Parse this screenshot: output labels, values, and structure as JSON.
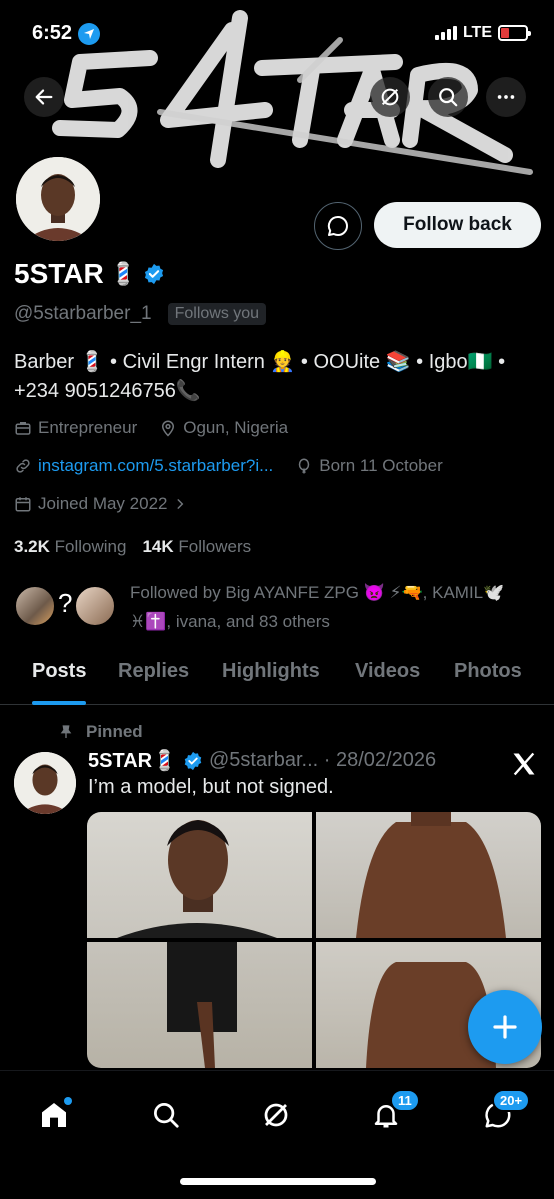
{
  "status_bar": {
    "time": "6:52",
    "network": "LTE"
  },
  "header": {
    "banner_text": "5STAR",
    "back_icon": "arrow-left-icon",
    "grok_icon": "grok-icon",
    "search_icon": "search-icon",
    "more_icon": "more-icon"
  },
  "profile": {
    "follow_back_label": "Follow back",
    "name": "5STAR",
    "name_emoji": "💈",
    "handle": "@5starbarber_1",
    "follows_you": "Follows you",
    "bio_line1": "Barber 💈 • Civil Engr Intern 👷 • OOUite 📚 • Igbo🇳🇬 •",
    "bio_line2": "+234 9051246756📞",
    "category": "Entrepreneur",
    "location": "Ogun, Nigeria",
    "website": "instagram.com/5.starbarber?i...",
    "birthday": "Born 11 October",
    "joined": "Joined May 2022",
    "following_count": "3.2K",
    "following_label": "Following",
    "followers_count": "14K",
    "followers_label": "Followers",
    "followed_by_line1": "Followed by Big AYANFE ZPG 👿 ⚡🔫, KAMIL🕊️",
    "followed_by_line2": "♓✝️, ivana, and 83 others"
  },
  "tabs": [
    "Posts",
    "Replies",
    "Highlights",
    "Videos",
    "Photos"
  ],
  "post": {
    "pinned_label": "Pinned",
    "name": "5STAR💈",
    "meta": "@5starbar... · 28/02/2026",
    "text": "I’m a model, but not signed."
  },
  "nav": {
    "notifications_badge": "11",
    "messages_badge": "20+"
  },
  "colors": {
    "accent": "#1d9bf0",
    "background": "#000000",
    "muted": "#71767b"
  }
}
